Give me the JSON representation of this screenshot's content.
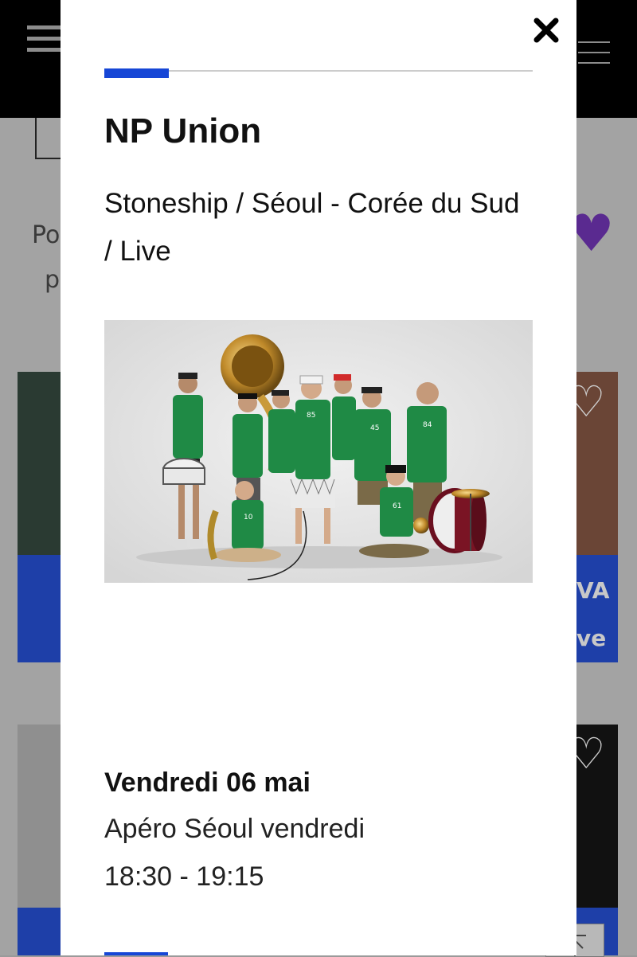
{
  "background": {
    "text_line1": "Po",
    "text_line2": "p",
    "card_right_line1": "VA",
    "card_right_line2": "ve"
  },
  "modal": {
    "title": "NP Union",
    "subtitle": "Stoneship / Séoul - Corée du Sud / Live",
    "progress_fraction": 0.15,
    "date": "Vendredi 06 mai",
    "venue": "Apéro Séoul vendredi",
    "time": "18:30 - 19:15"
  },
  "colors": {
    "accent": "#1646d6",
    "heart": "#5a2a90"
  },
  "icons": {
    "close": "close-icon",
    "menu": "menu-icon",
    "heart": "heart-icon",
    "back_to_top": "arrow-up-icon"
  }
}
